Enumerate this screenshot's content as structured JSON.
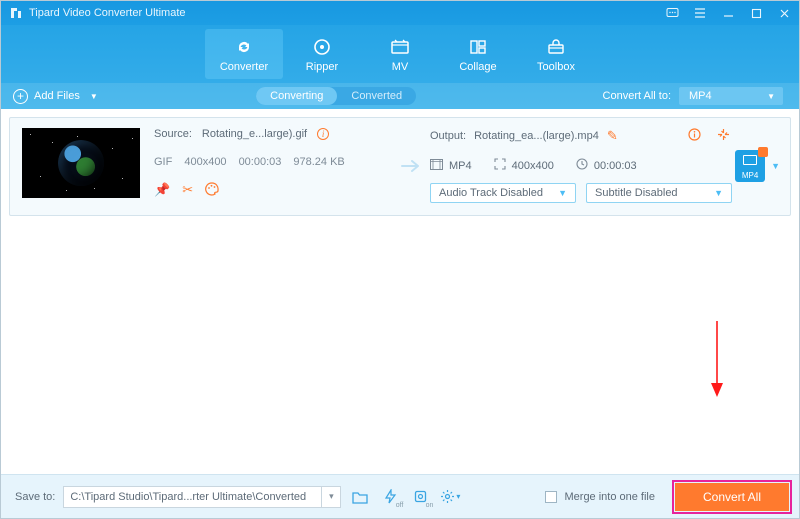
{
  "colors": {
    "accent": "#ff7a2e",
    "highlight": "#e7239b"
  },
  "title": "Tipard Video Converter Ultimate",
  "nav": {
    "active": 0,
    "tabs": [
      {
        "label": "Converter"
      },
      {
        "label": "Ripper"
      },
      {
        "label": "MV"
      },
      {
        "label": "Collage"
      },
      {
        "label": "Toolbox"
      }
    ]
  },
  "toolbar": {
    "add_label": "Add Files",
    "segment": {
      "options": [
        "Converting",
        "Converted"
      ],
      "active": 0
    },
    "convert_all_label": "Convert All to:",
    "convert_all_value": "MP4"
  },
  "item": {
    "source_label": "Source:",
    "source_name": "Rotating_e...large).gif",
    "source_meta": {
      "format": "GIF",
      "dimensions": "400x400",
      "duration": "00:00:03",
      "size": "978.24 KB"
    },
    "output_label": "Output:",
    "output_name": "Rotating_ea...(large).mp4",
    "output_meta": {
      "format": "MP4",
      "dimensions": "400x400",
      "duration": "00:00:03"
    },
    "audio_track": "Audio Track Disabled",
    "subtitle": "Subtitle Disabled",
    "format_tile": "MP4"
  },
  "footer": {
    "save_label": "Save to:",
    "save_path": "C:\\Tipard Studio\\Tipard...rter Ultimate\\Converted",
    "merge_label": "Merge into one file",
    "convert_button": "Convert All"
  }
}
